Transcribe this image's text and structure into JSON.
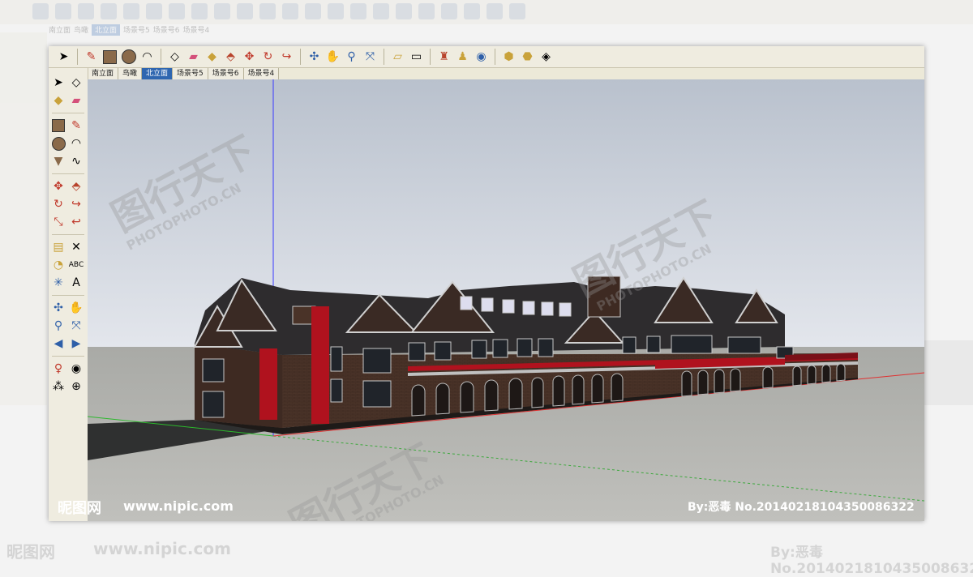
{
  "scene_tabs": [
    "南立面",
    "鸟瞰",
    "北立面",
    "场景号5",
    "场景号6",
    "场景号4"
  ],
  "active_tab": "北立面",
  "toolbar_icons": [
    "select-icon",
    "pencil-icon",
    "rectangle-icon",
    "circle-icon",
    "arc-icon",
    "component-icon",
    "eraser-icon",
    "paint-bucket-icon",
    "push-pull-icon",
    "move-icon",
    "rotate-icon",
    "follow-me-icon",
    "orbit-icon",
    "pan-icon",
    "zoom-icon",
    "zoom-extents-icon",
    "top-view-icon",
    "iso-view-icon",
    "shadow-icon",
    "walk-icon",
    "globe-icon",
    "warehouse-icon",
    "share-icon",
    "layers-icon"
  ],
  "left_icons": [
    "select-icon",
    "component-icon",
    "paint-bucket-icon",
    "eraser-icon",
    "rectangle-icon",
    "pencil-icon",
    "circle-icon",
    "arc-icon",
    "polygon-icon",
    "freehand-icon",
    "move-icon",
    "push-pull-icon",
    "rotate-icon",
    "follow-me-icon",
    "scale-icon",
    "offset-icon",
    "tape-measure-icon",
    "dimension-icon",
    "protractor-icon",
    "text-icon",
    "axes-icon",
    "3d-text-icon",
    "orbit-icon",
    "pan-icon",
    "zoom-icon",
    "zoom-window-icon",
    "previous-view-icon",
    "next-view-icon",
    "position-camera-icon",
    "look-around-icon",
    "walk-icon",
    "section-plane-icon"
  ],
  "watermark": {
    "site_cn": "昵图网",
    "site_url": "www.nipic.com",
    "author": "By:恶毒",
    "number": "No.20140218104350086322",
    "photo_cn": "图行天下",
    "photo_url": "PHOTOPHOTO.CN"
  },
  "colors": {
    "accent_tab": "#2f66b0",
    "sky_top": "#b9c1cd",
    "sky_bottom": "#e3e6ec",
    "ground": "#b6b6b2",
    "brick": "#4a3328",
    "roof": "#2e2c2e",
    "trim_red": "#b0121e"
  }
}
